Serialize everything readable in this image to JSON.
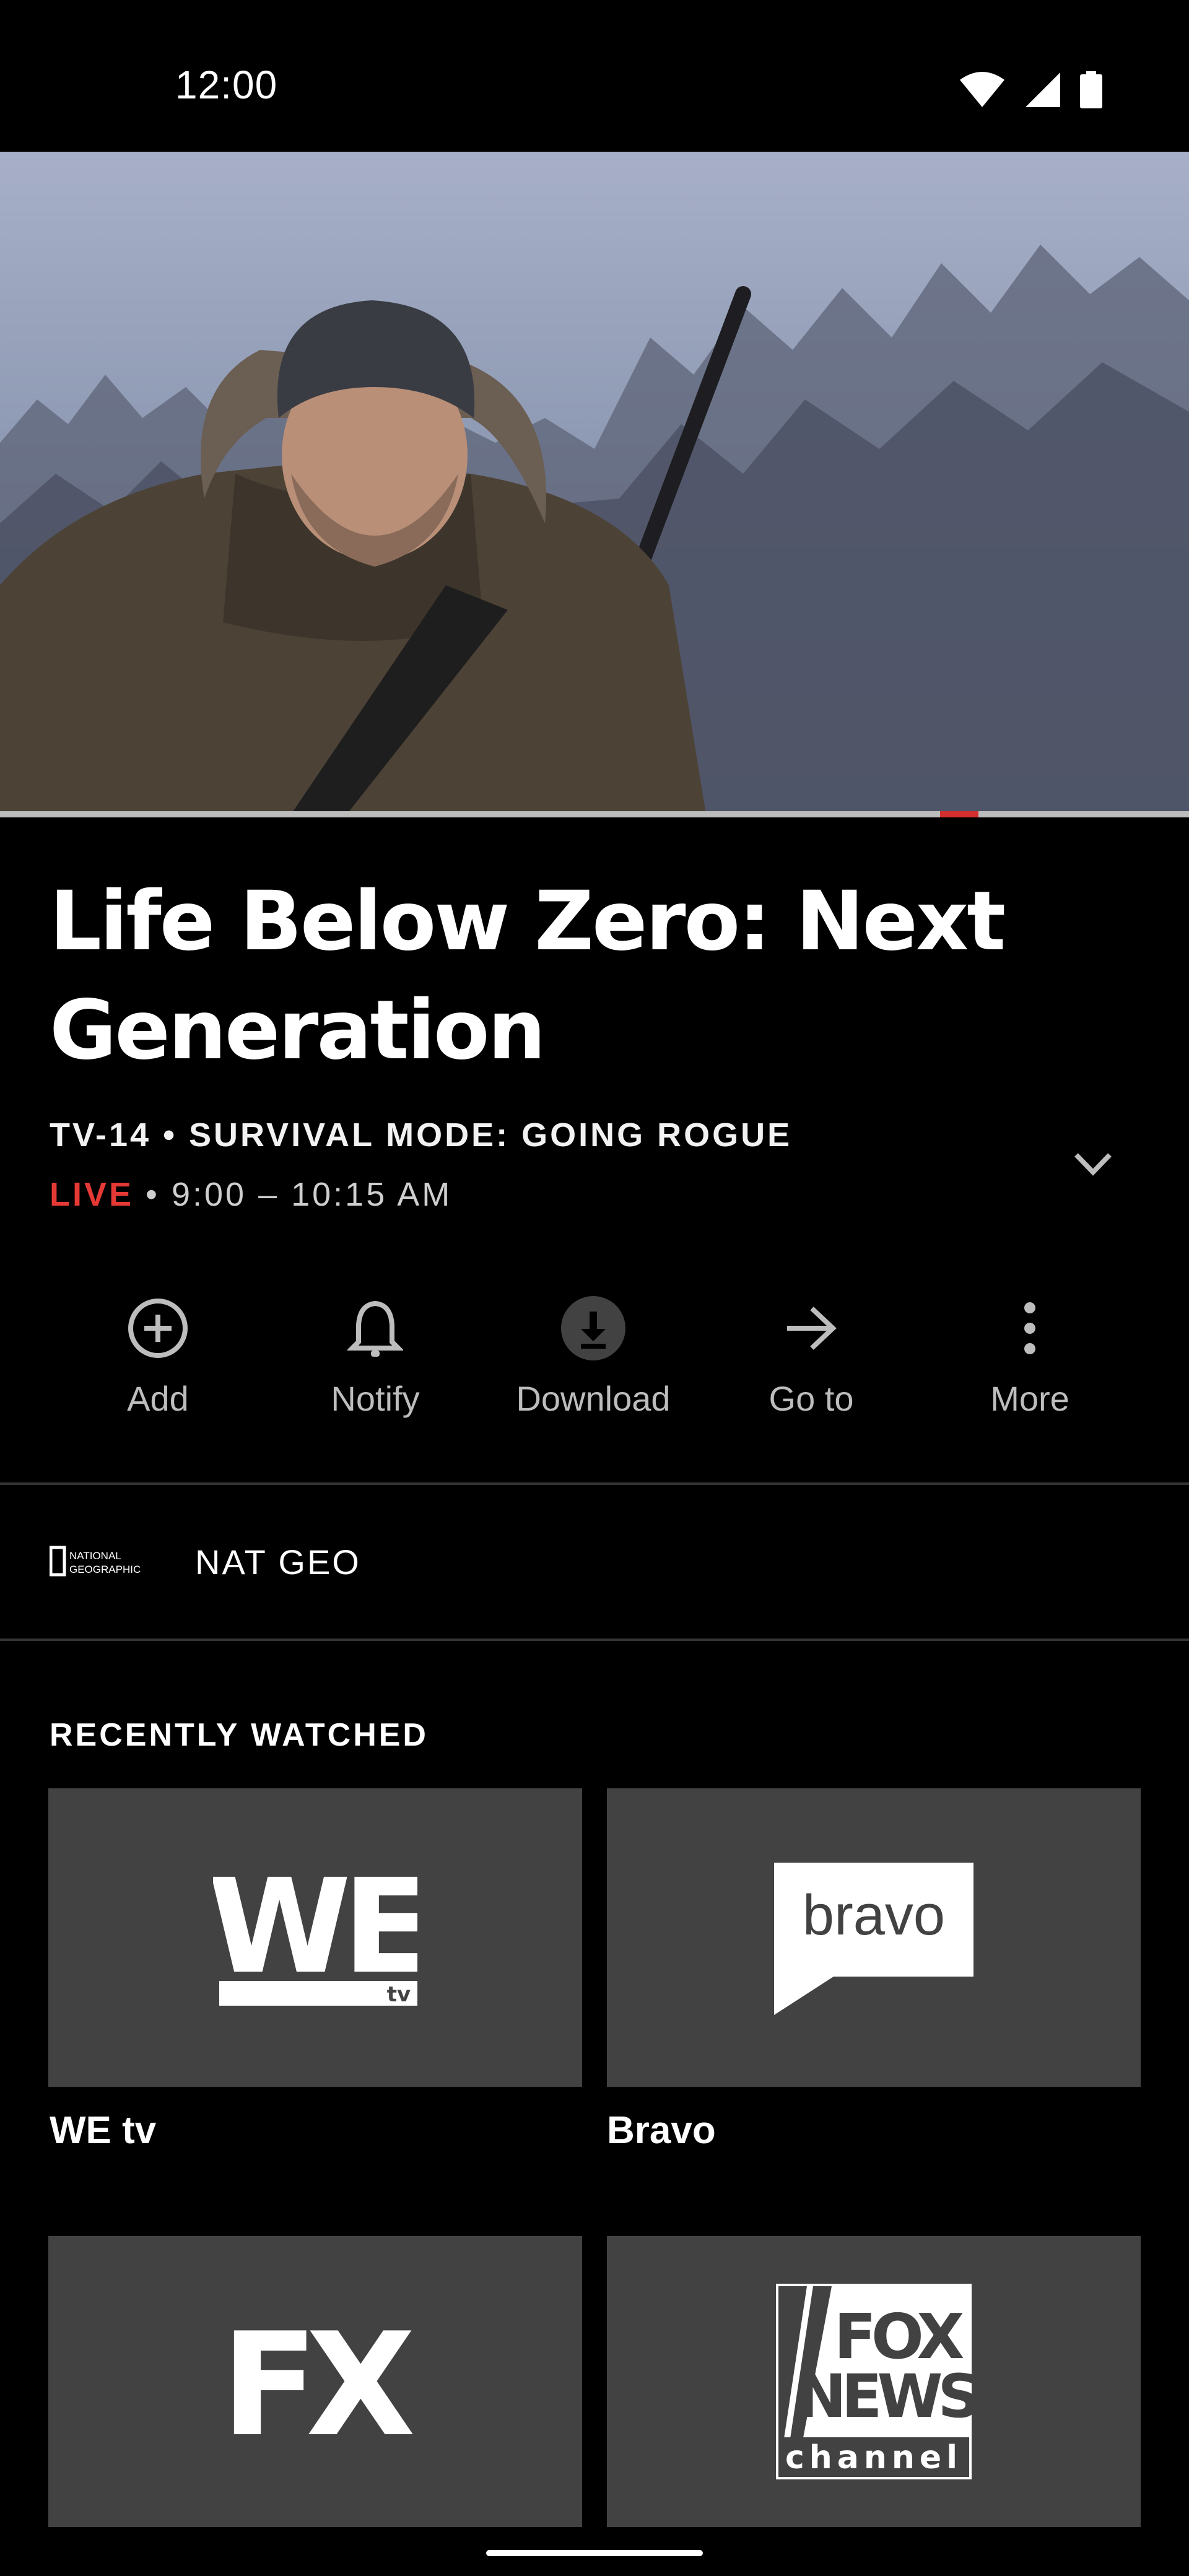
{
  "status_bar": {
    "time": "12:00"
  },
  "player": {
    "progress_marker_color": "#d32f2f"
  },
  "program": {
    "title": "Life Below Zero: Next Generation",
    "rating": "TV-14",
    "separator": "•",
    "episode_title": "SURVIVAL MODE: GOING ROGUE",
    "live_label": "LIVE",
    "time_range": "9:00 – 10:15 AM"
  },
  "actions": [
    {
      "label": "Add",
      "icon": "add-circle-icon"
    },
    {
      "label": "Notify",
      "icon": "bell-icon"
    },
    {
      "label": "Download",
      "icon": "download-icon"
    },
    {
      "label": "Go to",
      "icon": "arrow-right-icon"
    },
    {
      "label": "More",
      "icon": "more-vert-icon"
    }
  ],
  "channel": {
    "logo_text": [
      "NATIONAL",
      "GEOGRAPHIC"
    ],
    "name": "NAT GEO"
  },
  "recently_watched": {
    "heading": "RECENTLY WATCHED",
    "items": [
      {
        "label": "WE tv",
        "logo_text": "WE",
        "logo_sub": "tv"
      },
      {
        "label": "Bravo",
        "logo_text": "bravo"
      },
      {
        "label": "",
        "logo_text": "FX"
      },
      {
        "label": "",
        "logo_text": [
          "FOX",
          "NEWS",
          "channel"
        ]
      }
    ]
  },
  "colors": {
    "background": "#000000",
    "tile": "#424242",
    "live": "#e53935",
    "muted_text": "#bdbdbd"
  }
}
